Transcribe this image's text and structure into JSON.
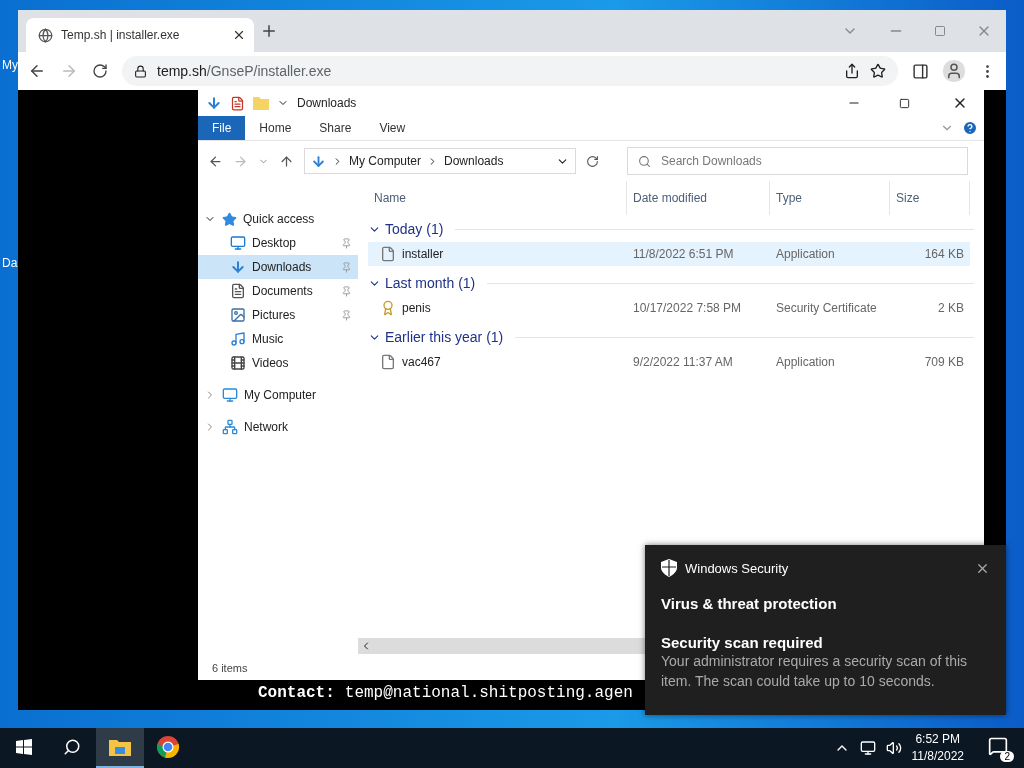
{
  "desktop_labels": [
    "My",
    "Da"
  ],
  "browser": {
    "tab": {
      "title": "Temp.sh | installer.exe",
      "selected": true
    },
    "url": {
      "host": "temp.sh",
      "path": "/GnseP/installer.exe"
    }
  },
  "explorer": {
    "title": "Downloads",
    "ribbon_tabs": [
      {
        "label": "File",
        "selected": true
      },
      {
        "label": "Home",
        "selected": false
      },
      {
        "label": "Share",
        "selected": false
      },
      {
        "label": "View",
        "selected": false
      }
    ],
    "address": [
      "My Computer",
      "Downloads"
    ],
    "search": {
      "placeholder": "Search Downloads"
    },
    "nav": [
      {
        "label": "Quick access",
        "kind": "star",
        "expanded": true,
        "children": [
          {
            "label": "Desktop",
            "kind": "desktop",
            "pinned": true,
            "selected": false
          },
          {
            "label": "Downloads",
            "kind": "downloads",
            "pinned": true,
            "selected": true
          },
          {
            "label": "Documents",
            "kind": "documents",
            "pinned": true,
            "selected": false
          },
          {
            "label": "Pictures",
            "kind": "pictures",
            "pinned": true,
            "selected": false
          },
          {
            "label": "Music",
            "kind": "music",
            "pinned": false,
            "selected": false
          },
          {
            "label": "Videos",
            "kind": "videos",
            "pinned": false,
            "selected": false
          }
        ]
      },
      {
        "label": "My Computer",
        "kind": "computer",
        "expanded": false
      },
      {
        "label": "Network",
        "kind": "network",
        "expanded": false
      }
    ],
    "columns": [
      "Name",
      "Date modified",
      "Type",
      "Size"
    ],
    "groups": [
      {
        "label": "Today (1)",
        "expanded": true,
        "files": [
          {
            "name": "installer",
            "date": "11/8/2022 6:51 PM",
            "type": "Application",
            "size": "164 KB",
            "kind": "application",
            "selected": true
          }
        ]
      },
      {
        "label": "Last month (1)",
        "expanded": true,
        "files": [
          {
            "name": "penis",
            "date": "10/17/2022 7:58 PM",
            "type": "Security Certificate",
            "size": "2 KB",
            "kind": "certificate",
            "selected": false
          }
        ]
      },
      {
        "label": "Earlier this year (1)",
        "expanded": true,
        "files": [
          {
            "name": "vac467",
            "date": "9/2/2022 11:37 AM",
            "type": "Application",
            "size": "709 KB",
            "kind": "application",
            "selected": false
          }
        ]
      }
    ],
    "status": "6 items"
  },
  "contact": {
    "label": "Contact:",
    "value": "temp@national.shitposting.agen"
  },
  "toast": {
    "app": "Windows Security",
    "title": "Virus & threat protection",
    "heading": "Security scan required",
    "body": "Your administrator requires a security scan of this item. The scan could take up to 10 seconds."
  },
  "taskbar": {
    "apps": [
      {
        "kind": "explorer",
        "active": true
      },
      {
        "kind": "chrome",
        "active": false
      }
    ],
    "time": "6:52 PM",
    "date": "11/8/2022",
    "notifications": "2"
  }
}
